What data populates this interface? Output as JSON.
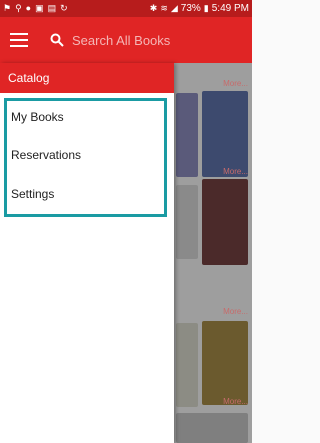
{
  "statusbar": {
    "left_icons": [
      "notification-icon",
      "app-icon",
      "chat-icon",
      "image-icon",
      "calendar-icon",
      "sync-icon"
    ],
    "right_icons": [
      "bluetooth-icon",
      "wifi-icon",
      "signal-icon"
    ],
    "battery": "73%",
    "time": "5:49 PM"
  },
  "appbar": {
    "search_placeholder": "Search All Books"
  },
  "drawer": {
    "header": "Catalog",
    "items": [
      {
        "label": "My Books"
      },
      {
        "label": "Reservations"
      },
      {
        "label": "Settings"
      }
    ]
  },
  "background": {
    "sections": [
      {
        "more_label": "More..."
      },
      {
        "more_label": "More..."
      },
      {
        "more_label": "More..."
      },
      {
        "more_label": "More..."
      }
    ]
  },
  "colors": {
    "accent": "#e02525",
    "highlight": "#1a9ba3"
  }
}
